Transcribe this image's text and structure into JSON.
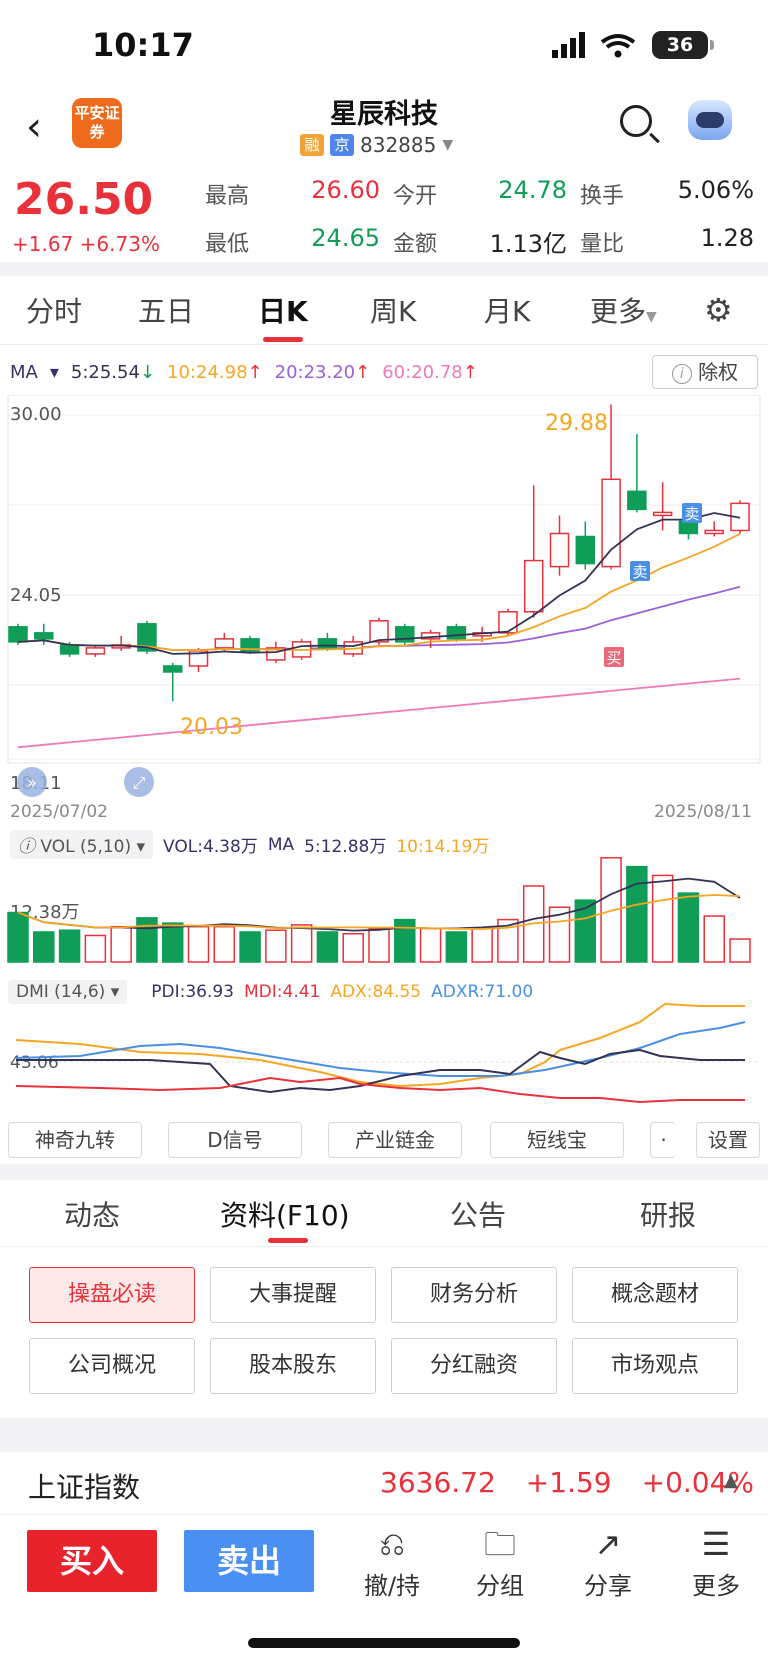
{
  "status_bar": {
    "time": "10:17",
    "battery": "36"
  },
  "header": {
    "logo_text": "平安证券",
    "stock_name": "星辰科技",
    "badge_margin": "融",
    "badge_exchange": "京",
    "stock_code": "832885"
  },
  "quote": {
    "price": "26.50",
    "change": "+1.67",
    "change_pct": "+6.73%",
    "high_label": "最高",
    "high": "26.60",
    "open_label": "今开",
    "open": "24.78",
    "turnover_label": "换手",
    "turnover": "5.06%",
    "low_label": "最低",
    "low": "24.65",
    "amount_label": "金额",
    "amount": "1.13亿",
    "vol_ratio_label": "量比",
    "vol_ratio": "1.28"
  },
  "period_tabs": [
    "分时",
    "五日",
    "日K",
    "周K",
    "月K",
    "更多"
  ],
  "active_period": "日K",
  "ma": {
    "label": "MA",
    "ma5": "5:25.54",
    "ma10": "10:24.98",
    "ma20": "20:23.20",
    "ma60": "60:20.78",
    "chuquan": "除权"
  },
  "kchart": {
    "y_top": "30.00",
    "y_mid": "24.05",
    "y_bottom": "18.11",
    "date_start": "2025/07/02",
    "date_end": "2025/08/11",
    "max_label": "29.88",
    "min_label": "20.03",
    "sell_tag": "卖",
    "buy_tag": "买"
  },
  "volume": {
    "header": "VOL (5,10)",
    "vol": "VOL:4.38万",
    "ma_label": "MA",
    "ma5": "5:12.88万",
    "ma10": "10:14.19万",
    "y_label": "12.38万"
  },
  "dmi": {
    "header": "DMI (14,6)",
    "pdi": "PDI:36.93",
    "mdi": "MDI:4.41",
    "adx": "ADX:84.55",
    "adxr": "ADXR:71.00",
    "y_label": "43.06"
  },
  "tools": [
    "神奇九转",
    "D信号",
    "产业链金",
    "短线宝",
    "设置"
  ],
  "bottom_tabs": [
    "动态",
    "资料(F10)",
    "公告",
    "研报"
  ],
  "active_bottom_tab": "资料(F10)",
  "f10_buttons": [
    "操盘必读",
    "大事提醒",
    "财务分析",
    "概念题材",
    "公司概况",
    "股本股东",
    "分红融资",
    "市场观点"
  ],
  "index": {
    "name": "上证指数",
    "value": "3636.72",
    "change": "+1.59",
    "change_pct": "+0.04%"
  },
  "actions": {
    "buy": "买入",
    "sell": "卖出",
    "revoke": "撤/持",
    "group": "分组",
    "share": "分享",
    "more": "更多"
  },
  "colors": {
    "up": "#e8313a",
    "down": "#0f9d58",
    "ma5": "#333355",
    "ma10": "#f5a623",
    "ma20": "#9b5fd8",
    "ma60": "#f07ab8"
  },
  "chart_data": {
    "type": "candlestick",
    "x_range": [
      "2025/07/02",
      "2025/08/11"
    ],
    "ylim": [
      18.11,
      30.0
    ],
    "candles": [
      {
        "o": 22.5,
        "c": 22.0,
        "h": 22.6,
        "l": 21.9
      },
      {
        "o": 22.3,
        "c": 22.1,
        "h": 22.6,
        "l": 21.9
      },
      {
        "o": 21.9,
        "c": 21.6,
        "h": 22.0,
        "l": 21.5
      },
      {
        "o": 21.6,
        "c": 21.8,
        "h": 21.9,
        "l": 21.5
      },
      {
        "o": 21.8,
        "c": 21.9,
        "h": 22.2,
        "l": 21.7
      },
      {
        "o": 22.6,
        "c": 21.7,
        "h": 22.7,
        "l": 21.6
      },
      {
        "o": 21.2,
        "c": 21.0,
        "h": 21.3,
        "l": 20.03
      },
      {
        "o": 21.2,
        "c": 21.7,
        "h": 21.8,
        "l": 21.0
      },
      {
        "o": 21.8,
        "c": 22.1,
        "h": 22.3,
        "l": 21.7
      },
      {
        "o": 22.1,
        "c": 21.7,
        "h": 22.2,
        "l": 21.6
      },
      {
        "o": 21.4,
        "c": 21.8,
        "h": 22.0,
        "l": 21.3
      },
      {
        "o": 21.5,
        "c": 22.0,
        "h": 22.1,
        "l": 21.4
      },
      {
        "o": 22.1,
        "c": 21.8,
        "h": 22.3,
        "l": 21.7
      },
      {
        "o": 21.6,
        "c": 22.0,
        "h": 22.2,
        "l": 21.5
      },
      {
        "o": 22.0,
        "c": 22.7,
        "h": 22.8,
        "l": 21.9
      },
      {
        "o": 22.5,
        "c": 22.0,
        "h": 22.6,
        "l": 21.9
      },
      {
        "o": 22.1,
        "c": 22.3,
        "h": 22.4,
        "l": 21.8
      },
      {
        "o": 22.5,
        "c": 22.1,
        "h": 22.6,
        "l": 22.0
      },
      {
        "o": 22.2,
        "c": 22.3,
        "h": 22.5,
        "l": 22.0
      },
      {
        "o": 22.3,
        "c": 23.0,
        "h": 23.1,
        "l": 22.2
      },
      {
        "o": 23.0,
        "c": 24.7,
        "h": 27.2,
        "l": 22.8
      },
      {
        "o": 24.5,
        "c": 25.6,
        "h": 26.2,
        "l": 24.2
      },
      {
        "o": 25.5,
        "c": 24.6,
        "h": 26.0,
        "l": 24.4
      },
      {
        "o": 24.5,
        "c": 27.4,
        "h": 29.88,
        "l": 24.4
      },
      {
        "o": 27.0,
        "c": 26.4,
        "h": 28.9,
        "l": 26.3
      },
      {
        "o": 26.2,
        "c": 26.3,
        "h": 27.3,
        "l": 25.7
      },
      {
        "o": 26.0,
        "c": 25.6,
        "h": 26.2,
        "l": 25.4
      },
      {
        "o": 25.6,
        "c": 25.7,
        "h": 26.0,
        "l": 25.5
      },
      {
        "o": 25.7,
        "c": 26.6,
        "h": 26.7,
        "l": 25.6
      }
    ],
    "volume": [
      14.0,
      8.5,
      9.0,
      7.5,
      10.0,
      12.5,
      11.0,
      10.0,
      10.0,
      8.5,
      9.0,
      10.5,
      8.5,
      8.0,
      9.5,
      12.0,
      9.5,
      8.5,
      9.5,
      12.0,
      21.5,
      15.5,
      17.5,
      29.5,
      27.0,
      24.5,
      19.5,
      13.0,
      6.5
    ]
  }
}
